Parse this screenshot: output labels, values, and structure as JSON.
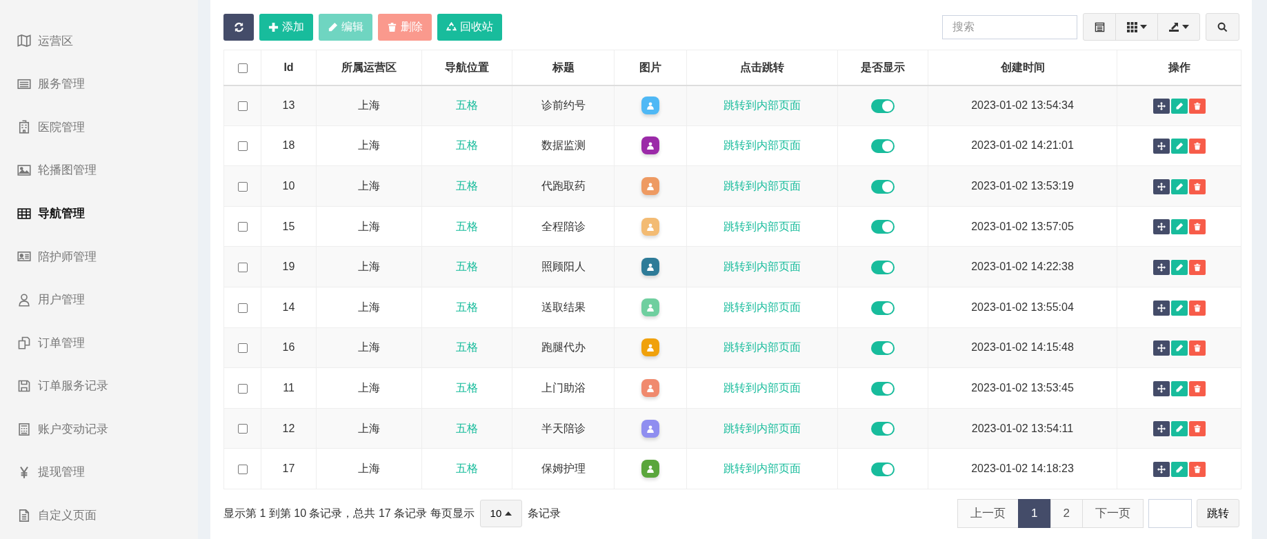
{
  "sidebar": {
    "items": [
      {
        "label": "运营区",
        "selected": false
      },
      {
        "label": "服务管理",
        "selected": false
      },
      {
        "label": "医院管理",
        "selected": false
      },
      {
        "label": "轮播图管理",
        "selected": false
      },
      {
        "label": "导航管理",
        "selected": true
      },
      {
        "label": "陪护师管理",
        "selected": false
      },
      {
        "label": "用户管理",
        "selected": false
      },
      {
        "label": "订单管理",
        "selected": false
      },
      {
        "label": "订单服务记录",
        "selected": false
      },
      {
        "label": "账户变动记录",
        "selected": false
      },
      {
        "label": "提现管理",
        "selected": false
      },
      {
        "label": "自定义页面",
        "selected": false
      }
    ]
  },
  "toolbar": {
    "buttons": [
      {
        "kind": "refresh",
        "disabled": false
      },
      {
        "kind": "add",
        "label": "添加",
        "disabled": false
      },
      {
        "kind": "edit",
        "label": "编辑",
        "disabled": true
      },
      {
        "kind": "delete",
        "label": "删除",
        "disabled": true
      },
      {
        "kind": "recycle",
        "label": "回收站",
        "disabled": false
      }
    ],
    "search": {
      "placeholder": "搜索"
    }
  },
  "table": {
    "header_checked": false,
    "columns": [
      "Id",
      "所属运营区",
      "导航位置",
      "标题",
      "图片",
      "点击跳转",
      "是否显示",
      "创建时间",
      "操作"
    ],
    "rows": [
      {
        "selected": false,
        "id": "13",
        "area": "上海",
        "position": "五格",
        "title": "诊前约号",
        "color": "#4fb8f5",
        "link": "跳转到内部页面",
        "on": true,
        "created": "2023-01-02 13:54:34"
      },
      {
        "selected": false,
        "id": "18",
        "area": "上海",
        "position": "五格",
        "title": "数据监测",
        "color": "#9b2aa8",
        "link": "跳转到内部页面",
        "on": true,
        "created": "2023-01-02 14:21:01"
      },
      {
        "selected": false,
        "id": "10",
        "area": "上海",
        "position": "五格",
        "title": "代跑取药",
        "color": "#ee9a62",
        "link": "跳转到内部页面",
        "on": true,
        "created": "2023-01-02 13:53:19"
      },
      {
        "selected": false,
        "id": "15",
        "area": "上海",
        "position": "五格",
        "title": "全程陪诊",
        "color": "#f3bb73",
        "link": "跳转到内部页面",
        "on": true,
        "created": "2023-01-02 13:57:05"
      },
      {
        "selected": false,
        "id": "19",
        "area": "上海",
        "position": "五格",
        "title": "照顾阳人",
        "color": "#2e7b98",
        "link": "跳转到内部页面",
        "on": true,
        "created": "2023-01-02 14:22:38"
      },
      {
        "selected": false,
        "id": "14",
        "area": "上海",
        "position": "五格",
        "title": "送取结果",
        "color": "#6fcf9f",
        "link": "跳转到内部页面",
        "on": true,
        "created": "2023-01-02 13:55:04"
      },
      {
        "selected": false,
        "id": "16",
        "area": "上海",
        "position": "五格",
        "title": "跑腿代办",
        "color": "#f0a10c",
        "link": "跳转到内部页面",
        "on": true,
        "created": "2023-01-02 14:15:48"
      },
      {
        "selected": false,
        "id": "11",
        "area": "上海",
        "position": "五格",
        "title": "上门助浴",
        "color": "#f08a6e",
        "link": "跳转到内部页面",
        "on": true,
        "created": "2023-01-02 13:53:45"
      },
      {
        "selected": false,
        "id": "12",
        "area": "上海",
        "position": "五格",
        "title": "半天陪诊",
        "color": "#8f8ef0",
        "link": "跳转到内部页面",
        "on": true,
        "created": "2023-01-02 13:54:11"
      },
      {
        "selected": false,
        "id": "17",
        "area": "上海",
        "position": "五格",
        "title": "保姆护理",
        "color": "#5aa63c",
        "link": "跳转到内部页面",
        "on": true,
        "created": "2023-01-02 14:18:23"
      }
    ]
  },
  "footer": {
    "summary": "显示第 1 到第 10 条记录，总共 17 条记录 每页显示",
    "page_size": "10",
    "suffix": "条记录",
    "pages": [
      {
        "label": "上一页",
        "selected": false
      },
      {
        "label": "1",
        "selected": true
      },
      {
        "label": "2",
        "selected": false
      },
      {
        "label": "下一页",
        "selected": false
      }
    ],
    "jump": "跳转"
  }
}
